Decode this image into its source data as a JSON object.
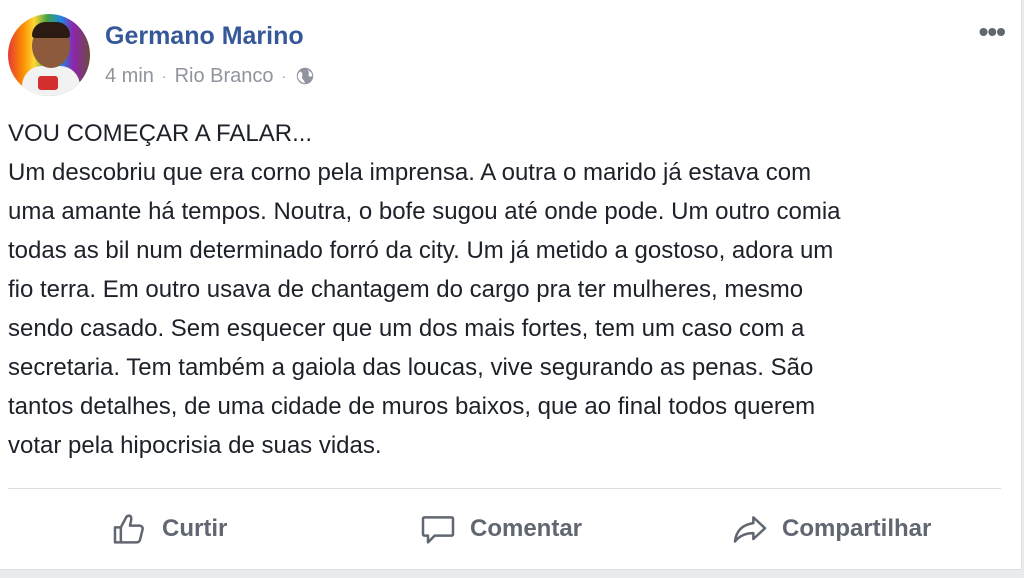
{
  "post": {
    "author": "Germano Marino",
    "time": "4 min",
    "location": "Rio Branco",
    "separator": "·",
    "privacy_icon": "globe-icon",
    "more_icon": "more-options-icon",
    "more_label": "•••",
    "text": "VOU COMEÇAR A FALAR...\nUm descobriu que era corno pela imprensa. A outra o marido já estava com\numa amante há tempos. Noutra, o bofe sugou até onde pode. Um outro comia\ntodas as bil num determinado forró da city. Um já metido a gostoso, adora um\nfio terra. Em outro usava de chantagem do cargo pra ter mulheres, mesmo\nsendo casado. Sem esquecer que um dos mais fortes, tem um caso com a\nsecretaria. Tem também a gaiola das loucas, vive segurando as penas. São\ntantos detalhes, de uma cidade de muros baixos, que ao final todos querem\nvotar pela hipocrisia de suas vidas."
  },
  "actions": {
    "like_label": "Curtir",
    "comment_label": "Comentar",
    "share_label": "Compartilhar"
  },
  "colors": {
    "author_link": "#365899",
    "meta": "#90949c",
    "action_text": "#606770",
    "body_text": "#1d2129"
  }
}
